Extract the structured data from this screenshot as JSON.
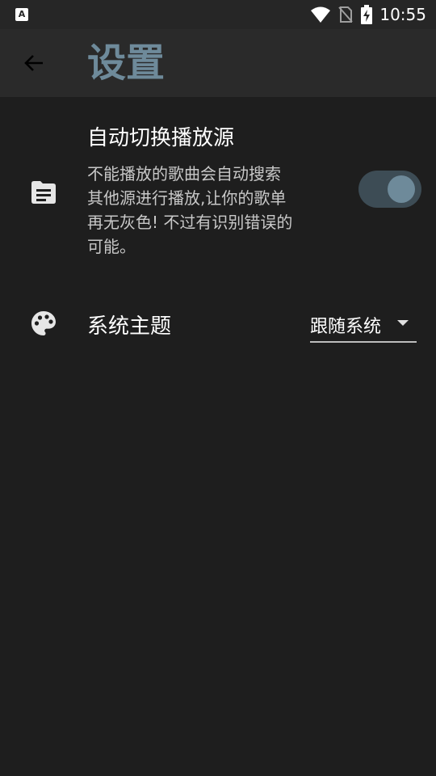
{
  "status_bar": {
    "left_icon": "A",
    "time": "10:55",
    "icons": [
      "wifi-icon",
      "no-sim-icon",
      "battery-charging-icon"
    ]
  },
  "app_bar": {
    "title": "设置",
    "back_icon": "arrow-left-icon"
  },
  "settings": {
    "auto_switch": {
      "icon": "document-icon",
      "title": "自动切换播放源",
      "description": "不能播放的歌曲会自动搜索\n其他源进行播放,让你的歌单\n再无灰色! 不过有识别错误的\n可能。",
      "enabled": true
    },
    "theme": {
      "icon": "palette-icon",
      "label": "系统主题",
      "selected": "跟随系统"
    }
  },
  "colors": {
    "background": "#1e1e1e",
    "app_bar": "#2a2a2a",
    "accent": "#6e8a9a"
  }
}
